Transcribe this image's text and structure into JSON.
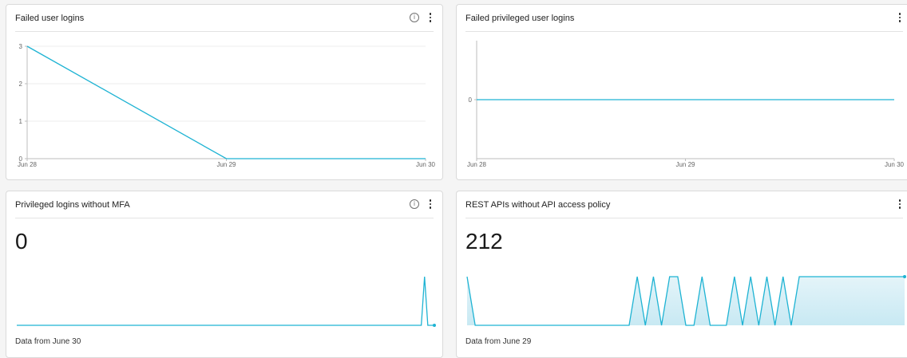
{
  "colors": {
    "line": "#1eb3d3",
    "fill_top": "#e4f4f9",
    "fill_bottom": "#c8e9f3",
    "grid": "#ececec",
    "axis": "#bdbdbd"
  },
  "icons": {
    "info": "info-icon",
    "menu": "kebab-menu-icon"
  },
  "widgets": [
    {
      "title": "Failed user logins",
      "chart_data": {
        "type": "line",
        "x": [
          "Jun 28",
          "Jun 29",
          "Jun 30"
        ],
        "x_tick_labels": [
          "Jun 28",
          "Jun 29",
          "Jun 30"
        ],
        "series": [
          {
            "values": [
              3,
              0,
              0
            ]
          }
        ],
        "y_tick_labels": [
          "0",
          "1",
          "2",
          "3"
        ],
        "ylim": [
          0,
          3
        ],
        "grid": true
      }
    },
    {
      "title": "Failed privileged user logins",
      "chart_data": {
        "type": "line",
        "x": [
          "Jun 28",
          "Jun 29",
          "Jun 30"
        ],
        "x_tick_labels": [
          "Jun 28",
          "Jun 29",
          "Jun 30"
        ],
        "series": [
          {
            "values": [
              0,
              0,
              0
            ]
          }
        ],
        "y_tick_labels": [
          "0"
        ],
        "grid": false
      }
    },
    {
      "title": "Privileged logins without MFA",
      "value": "0",
      "footer": "Data from June 30",
      "chart_data": {
        "type": "line",
        "series": [
          {
            "values": [
              0,
              0,
              0,
              0,
              0,
              0,
              0,
              0,
              0,
              0,
              0,
              0,
              0,
              0,
              0,
              0,
              0,
              0,
              0,
              0,
              0,
              0,
              0,
              0,
              0,
              0,
              0,
              0,
              0,
              0,
              0,
              0,
              0,
              0,
              0,
              0,
              0,
              0,
              0,
              0,
              0,
              0,
              0,
              0,
              0,
              0,
              0,
              0,
              0,
              0,
              0,
              0,
              0,
              0,
              0,
              0,
              0,
              0,
              0,
              0,
              0,
              0,
              0,
              0,
              0,
              0,
              0,
              0,
              0,
              0,
              0,
              0,
              0,
              0,
              0,
              0,
              0,
              0,
              0,
              0,
              0,
              0,
              0,
              0,
              0,
              0,
              0,
              0,
              0,
              0,
              0,
              0,
              0,
              0,
              0,
              0,
              0,
              0,
              0,
              0,
              0,
              0,
              0,
              0,
              0,
              0,
              0,
              0,
              0,
              0,
              0,
              0,
              0,
              0,
              0,
              0,
              0,
              0,
              0,
              0,
              0,
              0,
              0,
              0,
              0,
              1,
              0,
              0,
              0
            ]
          }
        ],
        "ylim": [
          0,
          1
        ]
      }
    },
    {
      "title": "REST APIs without API access policy",
      "value": "212",
      "footer": "Data from June 29",
      "chart_data": {
        "type": "area",
        "series": [
          {
            "values": [
              212,
              211,
              211,
              211,
              211,
              211,
              211,
              211,
              211,
              211,
              211,
              211,
              211,
              211,
              211,
              211,
              211,
              211,
              211,
              211,
              211,
              212,
              211,
              212,
              211,
              212,
              212,
              211,
              211,
              212,
              211,
              211,
              211,
              212,
              211,
              212,
              211,
              212,
              211,
              212,
              211,
              212,
              212,
              212,
              212,
              212,
              212,
              212,
              212,
              212,
              212,
              212,
              212,
              212,
              212
            ]
          }
        ],
        "ylim": [
          211,
          212
        ]
      }
    }
  ]
}
